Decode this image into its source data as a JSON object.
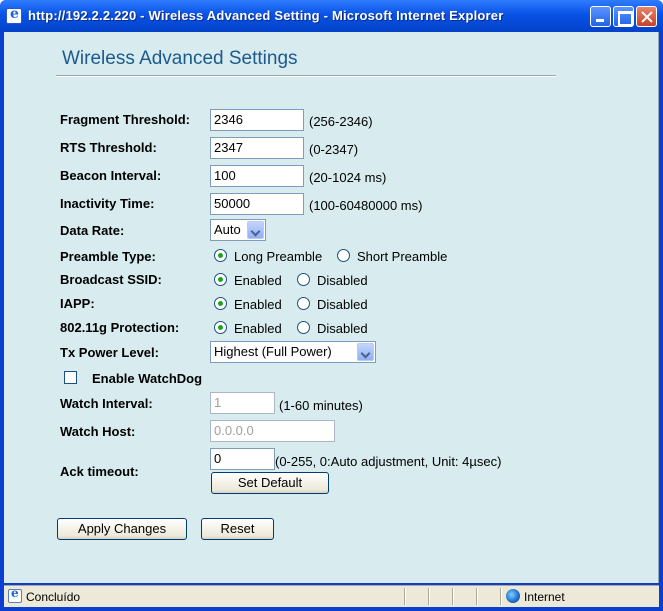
{
  "window": {
    "title": "http://192.2.2.220 - Wireless Advanced Setting - Microsoft Internet Explorer"
  },
  "page": {
    "heading": "Wireless Advanced Settings"
  },
  "form": {
    "fragment": {
      "label": "Fragment Threshold:",
      "value": "2346",
      "hint": "(256-2346)"
    },
    "rts": {
      "label": "RTS Threshold:",
      "value": "2347",
      "hint": "(0-2347)"
    },
    "beacon": {
      "label": "Beacon Interval:",
      "value": "100",
      "hint": "(20-1024 ms)"
    },
    "inactivity": {
      "label": "Inactivity Time:",
      "value": "50000",
      "hint": "(100-60480000 ms)"
    },
    "datarate": {
      "label": "Data Rate:",
      "selected": "Auto"
    },
    "preamble": {
      "label": "Preamble Type:",
      "opt1": "Long Preamble",
      "opt2": "Short Preamble",
      "selected": "Long Preamble"
    },
    "ssid": {
      "label": "Broadcast SSID:",
      "opt1": "Enabled",
      "opt2": "Disabled",
      "selected": "Enabled"
    },
    "iapp": {
      "label": "IAPP:",
      "opt1": "Enabled",
      "opt2": "Disabled",
      "selected": "Enabled"
    },
    "protection": {
      "label": "802.11g Protection:",
      "opt1": "Enabled",
      "opt2": "Disabled",
      "selected": "Enabled"
    },
    "txpower": {
      "label": "Tx Power Level:",
      "selected": "Highest (Full Power)"
    },
    "watchdog": {
      "label": "Enable WatchDog",
      "checked": false
    },
    "watch_interval": {
      "label": "Watch Interval:",
      "value": "1",
      "hint": "(1-60 minutes)"
    },
    "watch_host": {
      "label": "Watch Host:",
      "value": "0.0.0.0"
    },
    "ack": {
      "label": "Ack timeout:",
      "value": "0",
      "hint": "(0-255, 0:Auto adjustment, Unit: 4µsec)",
      "default_label": "Set Default"
    }
  },
  "actions": {
    "apply_label": "Apply Changes",
    "reset_label": "Reset"
  },
  "status": {
    "text": "Concluído",
    "zone": "Internet"
  }
}
